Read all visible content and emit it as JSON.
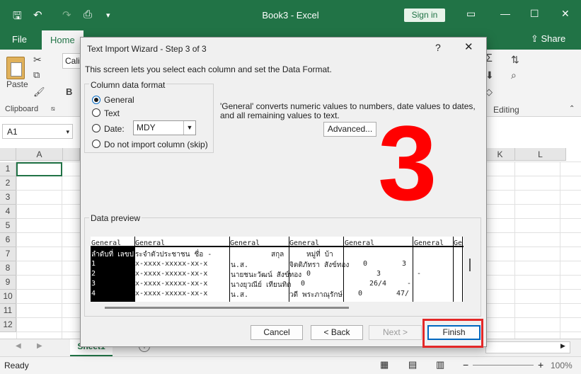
{
  "window": {
    "title": "Book3  -  Excel",
    "sign_in": "Sign in",
    "minimize_icon": "minimize-icon",
    "restore_icon": "restore-icon",
    "close_icon": "close-icon"
  },
  "ribbon": {
    "tabs": [
      "File",
      "Home"
    ],
    "share": "Share",
    "paste_label": "Paste",
    "clipboard_label": "Clipboard",
    "editing_label": "Editing",
    "font_box": "Cali"
  },
  "formula_bar": {
    "name_box": "A1"
  },
  "grid": {
    "columns": [
      "A",
      "K",
      "L"
    ],
    "rows": [
      "1",
      "2",
      "3",
      "4",
      "5",
      "6",
      "7",
      "8",
      "9",
      "10",
      "11",
      "12"
    ]
  },
  "sheet_tab": "Sheet1",
  "status": {
    "ready": "Ready",
    "zoom": "100%"
  },
  "dialog": {
    "title": "Text Import Wizard - Step 3 of 3",
    "help": "?",
    "close": "✕",
    "description": "This screen lets you select each column and set the Data Format.",
    "format_group_label": "Column data format",
    "options": {
      "general": "General",
      "text": "Text",
      "date": "Date:",
      "skip": "Do not import column (skip)"
    },
    "date_format": "MDY",
    "explanation": "'General' converts numeric values to numbers, date values to dates, and all remaining values to text.",
    "advanced_button": "Advanced...",
    "preview_label": "Data preview",
    "preview_headers": [
      "General",
      "General",
      "General",
      "General",
      "General",
      "General",
      "Ge"
    ],
    "preview_rows": [
      [
        "ลำดับที่ เลขป",
        "ระจำตัวประชาชน ชื่อ    -",
        "สกุล",
        "หมู่ที่ บ้า",
        "",
        "",
        ""
      ],
      [
        "1",
        "x-xxxx-xxxxx-xx-x",
        "น.ส.",
        "จิตติภัทรา สังข์ทอง",
        "0",
        "3",
        ""
      ],
      [
        "2",
        "x-xxxx-xxxxx-xx-x",
        "นายชนะวัฒน์ สังข์ทอง",
        "0",
        "3",
        "-",
        ""
      ],
      [
        "3",
        "x-xxxx-xxxxx-xx-x",
        "นางยุวณีย์ เทียนทิด",
        "0",
        "26/4",
        "-",
        ""
      ],
      [
        "4",
        "x-xxxx-xxxxx-xx-x",
        "น.ส.",
        "วดี    พระภาณุรักษ์",
        "0",
        "47/",
        ""
      ]
    ],
    "buttons": {
      "cancel": "Cancel",
      "back": "< Back",
      "next": "Next >",
      "finish": "Finish"
    },
    "step_number": "3"
  },
  "colors": {
    "excel_green": "#217346",
    "highlight_red": "#e32828",
    "big_number_red": "#ff0000"
  }
}
